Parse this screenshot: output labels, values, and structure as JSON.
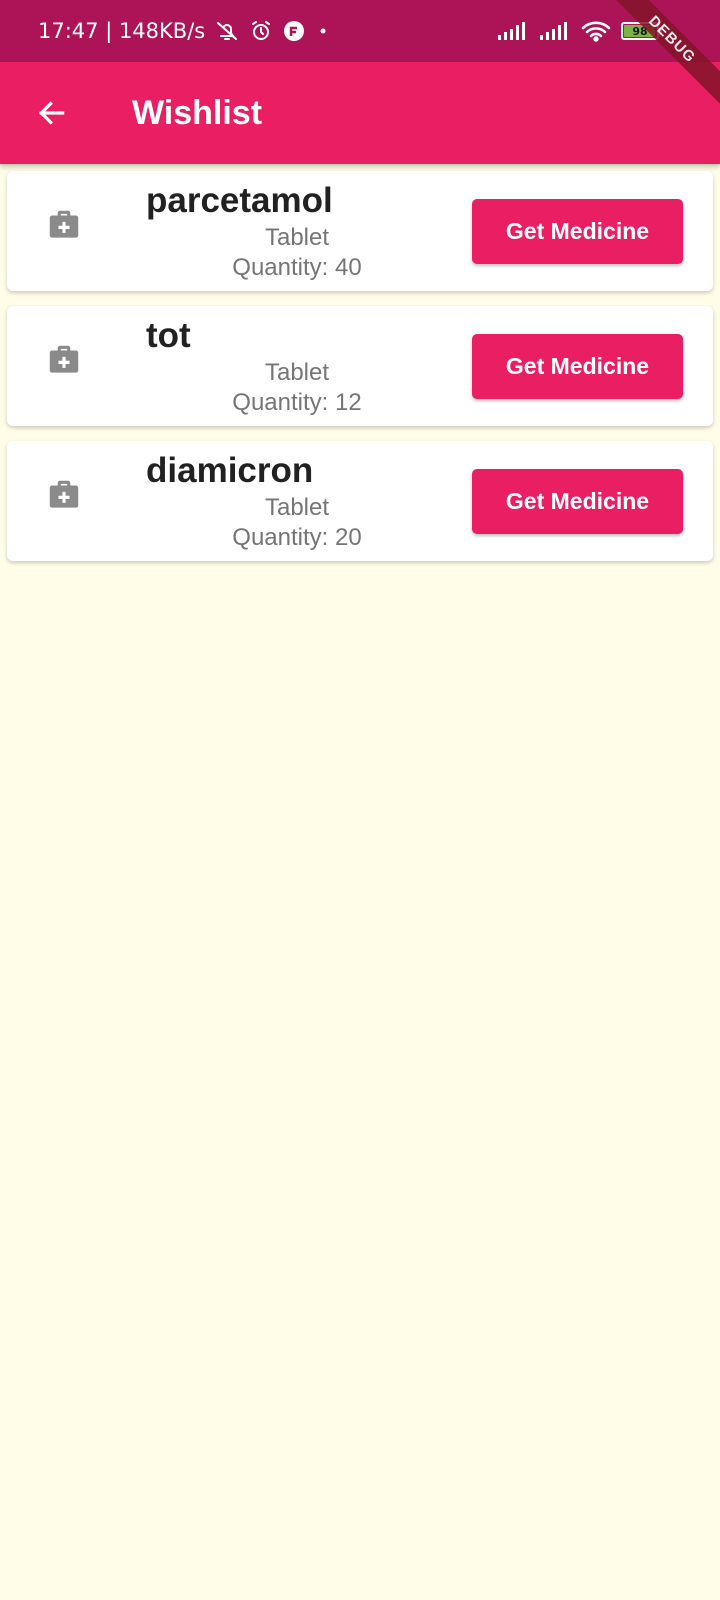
{
  "status_bar": {
    "time_speed": "17:47 | 148KB/s",
    "battery_level": "98",
    "battery_fraction": 0.98,
    "icons": [
      "dnd-bell-off-icon",
      "alarm-icon",
      "app-notification-icon",
      "dot-icon",
      "signal-icon",
      "signal-icon",
      "wifi-icon",
      "battery-icon"
    ]
  },
  "debug_banner": "DEBUG",
  "app_bar": {
    "back_icon": "arrow-back-icon",
    "title": "Wishlist"
  },
  "colors": {
    "primary": "#E91E63",
    "status_bar": "#AD1457",
    "background": "#FFFDE7",
    "icon_grey": "#8A8A8A"
  },
  "wishlist": {
    "items": [
      {
        "name": "parcetamol",
        "type": "Tablet",
        "quantity": "Quantity: 40",
        "icon": "medical-bag-icon",
        "button_label": "Get Medicine"
      },
      {
        "name": "tot",
        "type": "Tablet",
        "quantity": "Quantity: 12",
        "icon": "medical-bag-icon",
        "button_label": "Get Medicine"
      },
      {
        "name": "diamicron",
        "type": "Tablet",
        "quantity": "Quantity: 20",
        "icon": "medical-bag-icon",
        "button_label": "Get Medicine"
      }
    ]
  }
}
